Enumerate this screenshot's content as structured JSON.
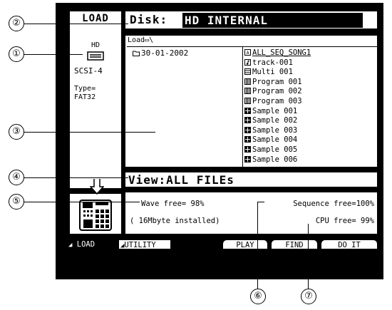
{
  "left": {
    "title": "LOAD",
    "drive_label": "HD",
    "scsi": "SCSI-4",
    "type_label": "Type=",
    "type_value": "FAT32"
  },
  "disk": {
    "label": "Disk:",
    "value": "HD INTERNAL"
  },
  "browser": {
    "path": "Load▭\\",
    "folder": "30-01-2002",
    "files": [
      {
        "icon": "all-seq-icon",
        "name": "ALL_SEQ_SONG1"
      },
      {
        "icon": "track-icon",
        "name": "track-001"
      },
      {
        "icon": "multi-icon",
        "name": "Multi 001"
      },
      {
        "icon": "program-icon",
        "name": "Program 001"
      },
      {
        "icon": "program-icon",
        "name": "Program 002"
      },
      {
        "icon": "program-icon",
        "name": "Program 003"
      },
      {
        "icon": "sample-icon",
        "name": "Sample 001"
      },
      {
        "icon": "sample-icon",
        "name": "Sample 002"
      },
      {
        "icon": "sample-icon",
        "name": "Sample 003"
      },
      {
        "icon": "sample-icon",
        "name": "Sample 004"
      },
      {
        "icon": "sample-icon",
        "name": "Sample 005"
      },
      {
        "icon": "sample-icon",
        "name": "Sample 006"
      }
    ]
  },
  "view": {
    "text": "View:ALL FILEs"
  },
  "info": {
    "wave_free": "Wave free= 98%",
    "installed": "( 16Mbyte installed)",
    "sequence_free": "Sequence free=100%",
    "cpu_free": "CPU free= 99%"
  },
  "softkeys": {
    "load": "LOAD",
    "utility": "UTILITY",
    "play": "PLAY",
    "find": "FIND",
    "do_it": "DO IT"
  },
  "callouts": [
    "①",
    "②",
    "③",
    "④",
    "⑤",
    "⑥",
    "⑦"
  ]
}
